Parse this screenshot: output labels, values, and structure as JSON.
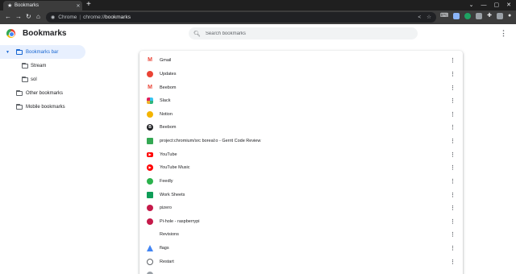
{
  "browser": {
    "tab": {
      "title": "Bookmarks",
      "favicon": "star-icon",
      "close_glyph": "✕"
    },
    "new_tab_glyph": "+",
    "window_controls": [
      "⌄",
      "—",
      "▢",
      "✕"
    ],
    "omnibox": {
      "site_label": "Chrome",
      "separator": "|",
      "url_prefix": "chrome://",
      "url_path": "bookmarks"
    }
  },
  "header": {
    "title": "Bookmarks",
    "search_placeholder": "Search bookmarks"
  },
  "sidebar": {
    "items": [
      {
        "label": "Bookmarks bar",
        "expanded": true,
        "selected": true,
        "indent": 0
      },
      {
        "label": "Stream",
        "indent": 1
      },
      {
        "label": "sol",
        "indent": 1
      },
      {
        "label": "Other bookmarks",
        "indent": 0
      },
      {
        "label": "Mobile bookmarks",
        "indent": 0
      }
    ]
  },
  "bookmarks": [
    {
      "title": "Gmail",
      "icon": "gmail-icon",
      "glyph": "M"
    },
    {
      "title": "Updates",
      "icon": "updates-icon",
      "glyph": ""
    },
    {
      "title": "Beebom",
      "icon": "beebom-gmail-icon",
      "glyph": "M"
    },
    {
      "title": "Slack",
      "icon": "slack-icon",
      "glyph": ""
    },
    {
      "title": "Notion",
      "icon": "notion-icon",
      "glyph": ""
    },
    {
      "title": "Beebom",
      "icon": "beebom-icon",
      "glyph": "B"
    },
    {
      "title": "project:chromium/src boreal:o - Gerrit Code Review",
      "icon": "gerrit-icon",
      "glyph": ""
    },
    {
      "title": "YouTube",
      "icon": "youtube-icon",
      "glyph": "▶"
    },
    {
      "title": "YouTube Music",
      "icon": "youtube-music-icon",
      "glyph": "▶"
    },
    {
      "title": "Feedly",
      "icon": "feedly-icon",
      "glyph": ""
    },
    {
      "title": "Work Sheets",
      "icon": "sheets-icon",
      "glyph": ""
    },
    {
      "title": "pizero",
      "icon": "raspberry-icon",
      "glyph": ""
    },
    {
      "title": "Pi-hole - raspberrypi",
      "icon": "raspberry-icon",
      "glyph": ""
    },
    {
      "title": "Revisions",
      "icon": "blank-icon",
      "glyph": ""
    },
    {
      "title": "flags",
      "icon": "flask-icon",
      "glyph": ""
    },
    {
      "title": "Restart",
      "icon": "restart-icon",
      "glyph": ""
    },
    {
      "title": "",
      "icon": "partial-icon",
      "glyph": ""
    }
  ],
  "row_menu_glyph": "⋮"
}
